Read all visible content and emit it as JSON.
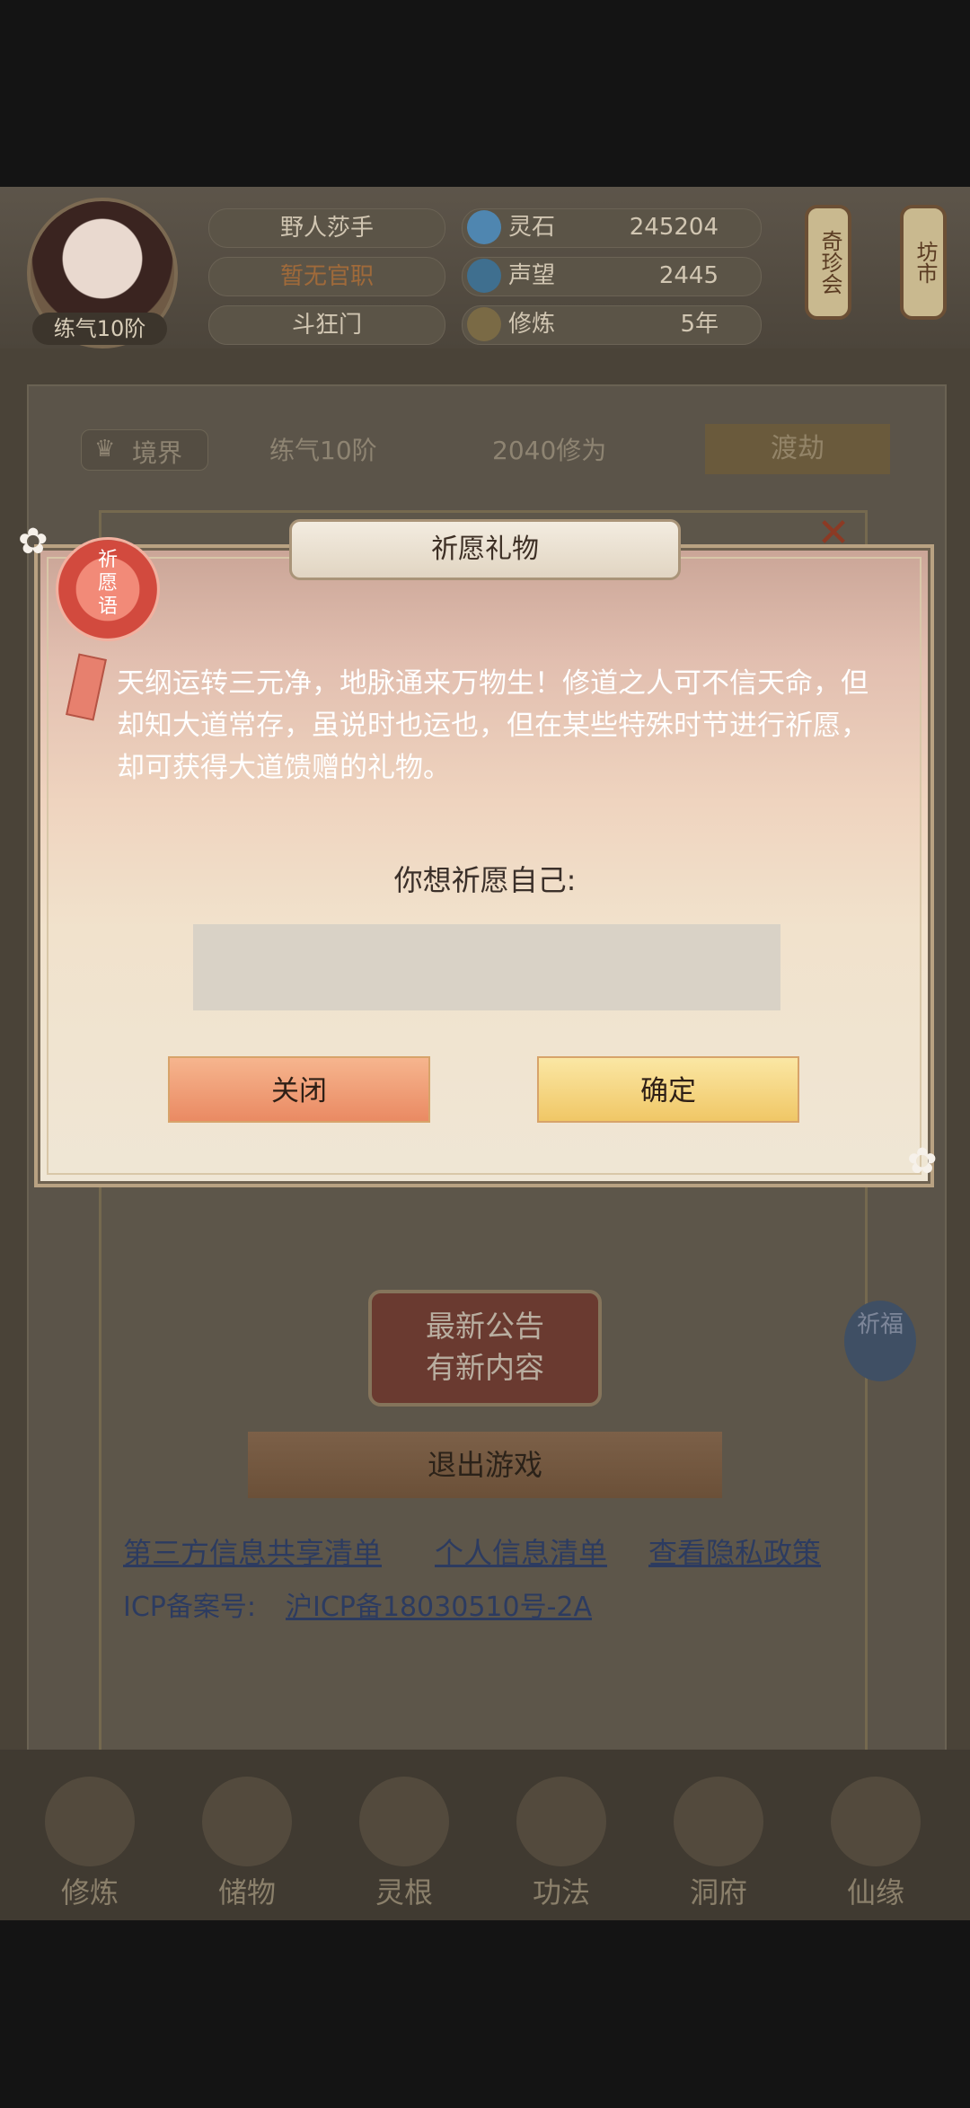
{
  "header": {
    "name": "野人莎手",
    "official_rank": "暂无官职",
    "sect": "斗狂门",
    "avatar_level": "练气10阶",
    "stats": [
      {
        "icon": "spirit-stone-icon",
        "label": "灵石",
        "value": "245204"
      },
      {
        "icon": "reputation-icon",
        "label": "声望",
        "value": "2445"
      },
      {
        "icon": "cultivation-icon",
        "label": "修炼",
        "value": "5年"
      }
    ],
    "lanterns": [
      {
        "label": "奇珍会"
      },
      {
        "label": "坊市"
      }
    ]
  },
  "realm": {
    "label": "境界",
    "level": "练气10阶",
    "exp": "2040修为",
    "action": "渡劫"
  },
  "background_panel": {
    "announcement_line1": "最新公告",
    "announcement_line2": "有新内容",
    "exit_button": "退出游戏",
    "side_icon_text": "祈福",
    "links": [
      "第三方信息共享清单",
      "个人信息清单",
      "查看隐私政策"
    ],
    "icp_label": "ICP备案号:",
    "icp_number": "沪ICP备18030510号-2A"
  },
  "nav": [
    {
      "label": "修炼",
      "icon": "cultivate-icon"
    },
    {
      "label": "储物",
      "icon": "storage-bag-icon"
    },
    {
      "label": "灵根",
      "icon": "spirit-root-icon"
    },
    {
      "label": "功法",
      "icon": "skill-book-icon"
    },
    {
      "label": "洞府",
      "icon": "cave-house-icon"
    },
    {
      "label": "仙缘",
      "icon": "fate-icon"
    }
  ],
  "dialog": {
    "title": "祈愿礼物",
    "badge_text": "祈愿语",
    "description": "天纲运转三元净，地脉通来万物生！修道之人可不信天命，但却知大道常存，虽说时也运也，但在某些特殊时节进行祈愿，却可获得大道馈赠的礼物。",
    "prompt": "你想祈愿自己:",
    "input_value": "",
    "close_button": "关闭",
    "confirm_button": "确定"
  },
  "colors": {
    "dialog_top": "#caa597",
    "dialog_bottom": "#efe6d5",
    "close_button": "#ea8a63",
    "confirm_button": "#f0c766",
    "link": "#2c3b60"
  }
}
